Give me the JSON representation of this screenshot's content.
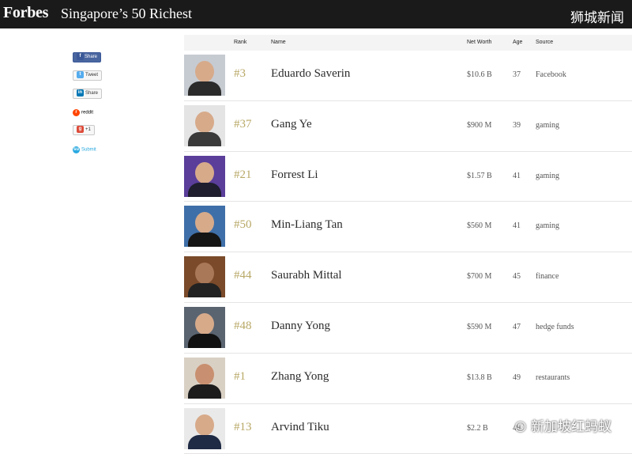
{
  "header": {
    "logo": "Forbes",
    "title": "Singapore’s 50 Richest",
    "brand_cn": "狮城新闻"
  },
  "share": [
    {
      "icon": "f",
      "label": "Share",
      "color": "#3b5998"
    },
    {
      "icon": "t",
      "label": "Tweet",
      "color": "#55acee"
    },
    {
      "icon": "in",
      "label": "Share",
      "color": "#0077b5"
    },
    {
      "icon": "r",
      "label": "reddit",
      "color": "#ff4500"
    },
    {
      "icon": "g",
      "label": "+1",
      "color": "#dd4b39"
    },
    {
      "icon": "su",
      "label": "Submit",
      "color": "#2aa9e0"
    }
  ],
  "table": {
    "headers": {
      "rank": "Rank",
      "name": "Name",
      "net": "Net Worth",
      "age": "Age",
      "source": "Source"
    },
    "rows": [
      {
        "rank": "#3",
        "name": "Eduardo Saverin",
        "net": "$10.6 B",
        "age": "37",
        "source": "Facebook"
      },
      {
        "rank": "#37",
        "name": "Gang Ye",
        "net": "$900 M",
        "age": "39",
        "source": "gaming"
      },
      {
        "rank": "#21",
        "name": "Forrest Li",
        "net": "$1.57 B",
        "age": "41",
        "source": "gaming"
      },
      {
        "rank": "#50",
        "name": "Min-Liang Tan",
        "net": "$560 M",
        "age": "41",
        "source": "gaming"
      },
      {
        "rank": "#44",
        "name": "Saurabh Mittal",
        "net": "$700 M",
        "age": "45",
        "source": "finance"
      },
      {
        "rank": "#48",
        "name": "Danny Yong",
        "net": "$590 M",
        "age": "47",
        "source": "hedge funds"
      },
      {
        "rank": "#1",
        "name": "Zhang Yong",
        "net": "$13.8 B",
        "age": "49",
        "source": "restaurants"
      },
      {
        "rank": "#13",
        "name": "Arvind Tiku",
        "net": "$2.2 B",
        "age": "49",
        "source": ""
      }
    ]
  },
  "watermark": "新加坡红蚂蚁"
}
